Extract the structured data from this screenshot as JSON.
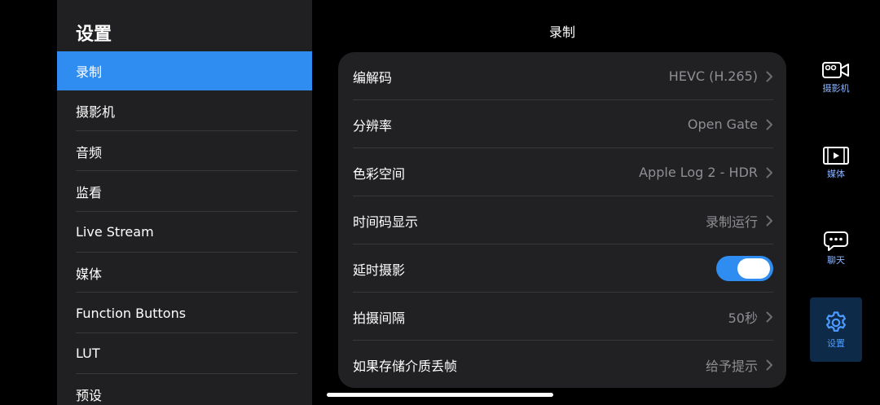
{
  "sidebar": {
    "title": "设置",
    "items": [
      {
        "label": "录制"
      },
      {
        "label": "摄影机"
      },
      {
        "label": "音频"
      },
      {
        "label": "监看"
      },
      {
        "label": "Live Stream"
      },
      {
        "label": "媒体"
      },
      {
        "label": "Function Buttons"
      },
      {
        "label": "LUT"
      },
      {
        "label": "预设"
      }
    ]
  },
  "header": {
    "title": "录制"
  },
  "settings": {
    "codec": {
      "label": "编解码",
      "value": "HEVC (H.265)"
    },
    "resolution": {
      "label": "分辨率",
      "value": "Open Gate"
    },
    "color_space": {
      "label": "色彩空间",
      "value": "Apple Log 2 - HDR"
    },
    "timecode": {
      "label": "时间码显示",
      "value": "录制运行"
    },
    "timelapse": {
      "label": "延时摄影",
      "enabled": true
    },
    "interval": {
      "label": "拍摄间隔",
      "value": "50秒"
    },
    "dropped_frames": {
      "label": "如果存储介质丢帧",
      "value": "给予提示"
    }
  },
  "right_nav": {
    "camera": {
      "label": "摄影机",
      "icon": "video-camera-icon"
    },
    "media": {
      "label": "媒体",
      "icon": "film-icon"
    },
    "chat": {
      "label": "聊天",
      "icon": "chat-bubble-icon"
    },
    "settings": {
      "label": "设置",
      "icon": "gear-icon"
    }
  },
  "colors": {
    "accent": "#2f8cf0",
    "panel": "#212123",
    "secondary_text": "#8e8e93"
  }
}
